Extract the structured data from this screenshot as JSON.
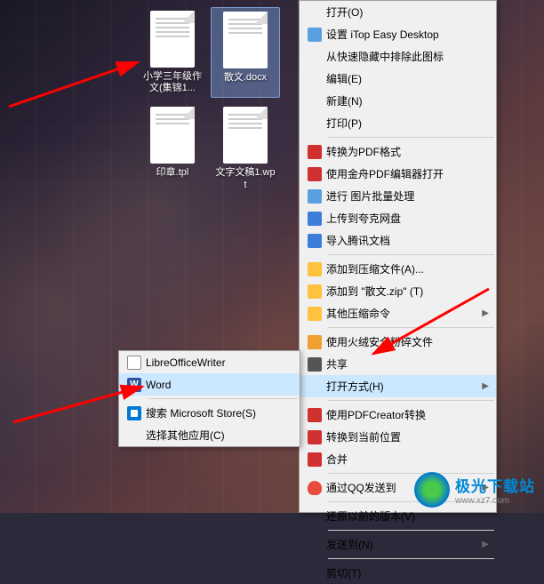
{
  "desktop": {
    "files": [
      {
        "label": "小学三年级作文(集锦1..."
      },
      {
        "label": "散文.docx",
        "selected": true
      },
      {
        "label": "印章.tpl"
      },
      {
        "label": "文字文稿1.wpt"
      }
    ]
  },
  "main_menu": {
    "items": [
      {
        "label": "打开(O)",
        "icon": null
      },
      {
        "label": "设置 iTop Easy Desktop",
        "icon": "grid"
      },
      {
        "label": "从快速隐藏中排除此图标",
        "icon": null
      },
      {
        "label": "编辑(E)",
        "icon": null
      },
      {
        "label": "新建(N)",
        "icon": null
      },
      {
        "label": "打印(P)",
        "icon": null
      },
      {
        "sep": true
      },
      {
        "label": "转换为PDF格式",
        "icon": "pdf"
      },
      {
        "label": "使用金舟PDF编辑器打开",
        "icon": "pdf"
      },
      {
        "label": "进行 图片批量处理",
        "icon": "img"
      },
      {
        "label": "上传到夸克网盘",
        "icon": "cloud"
      },
      {
        "label": "导入腾讯文档",
        "icon": "tencent"
      },
      {
        "sep": true
      },
      {
        "label": "添加到压缩文件(A)...",
        "icon": "zip"
      },
      {
        "label": "添加到 \"散文.zip\" (T)",
        "icon": "zip"
      },
      {
        "label": "其他压缩命令",
        "icon": "zip",
        "arrow": true
      },
      {
        "sep": true
      },
      {
        "label": "使用火绒安全粉碎文件",
        "icon": "huorong"
      },
      {
        "label": "共享",
        "icon": "share"
      },
      {
        "label": "打开方式(H)",
        "icon": null,
        "arrow": true,
        "hover": true
      },
      {
        "sep": true
      },
      {
        "label": "使用PDFCreator转换",
        "icon": "pdfcreator"
      },
      {
        "label": "转换到当前位置",
        "icon": "pdfcreator"
      },
      {
        "label": "合并",
        "icon": "pdfcreator"
      },
      {
        "sep": true
      },
      {
        "label": "通过QQ发送到",
        "icon": "qq",
        "arrow": true
      },
      {
        "sep": true
      },
      {
        "label": "还原以前的版本(V)",
        "icon": null
      },
      {
        "sep": true
      },
      {
        "label": "发送到(N)",
        "icon": null,
        "arrow": true
      },
      {
        "sep": true
      },
      {
        "label": "剪切(T)",
        "icon": null
      }
    ]
  },
  "sub_menu": {
    "items": [
      {
        "label": "LibreOfficeWriter",
        "icon": "lo"
      },
      {
        "label": "Word",
        "icon": "word",
        "hover": true
      },
      {
        "sep": true
      },
      {
        "label": "搜索 Microsoft Store(S)",
        "icon": "store"
      },
      {
        "label": "选择其他应用(C)",
        "icon": null
      }
    ]
  },
  "watermark": {
    "brand": "极光下载站",
    "url": "www.xz7.com"
  }
}
